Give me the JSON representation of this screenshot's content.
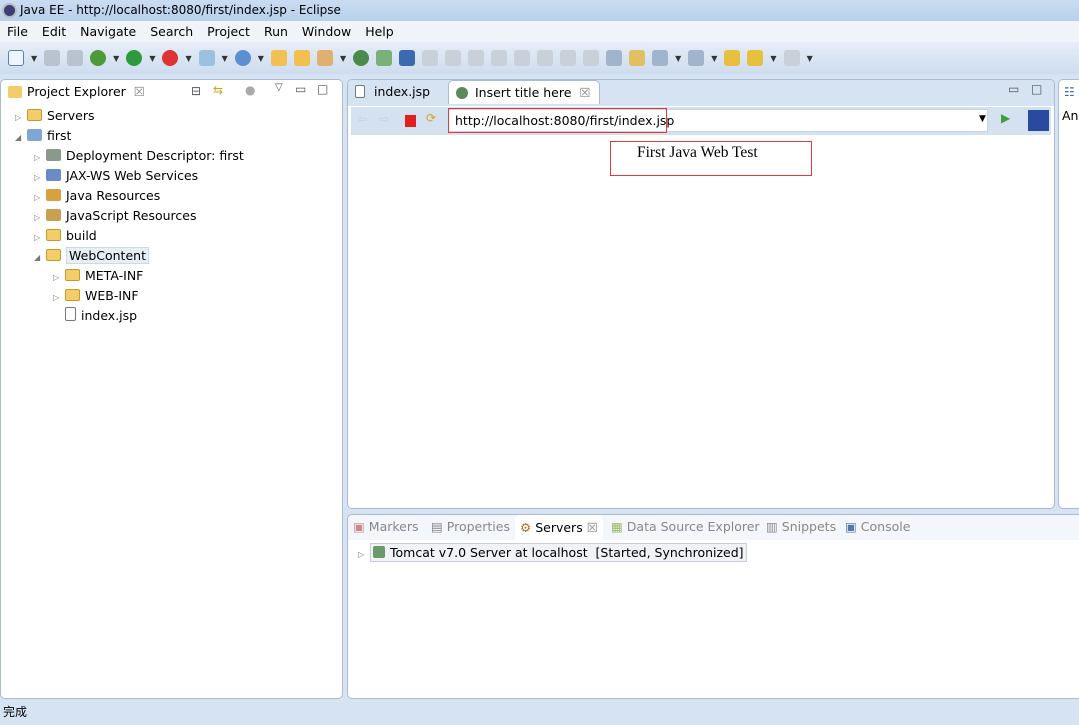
{
  "window": {
    "title": "Java EE - http://localhost:8080/first/index.jsp - Eclipse"
  },
  "menu": [
    "File",
    "Edit",
    "Navigate",
    "Search",
    "Project",
    "Run",
    "Window",
    "Help"
  ],
  "project_explorer": {
    "title": "Project Explorer",
    "items": [
      {
        "label": "Servers"
      },
      {
        "label": "first"
      },
      {
        "label": "Deployment Descriptor: first"
      },
      {
        "label": "JAX-WS Web Services"
      },
      {
        "label": "Java Resources"
      },
      {
        "label": "JavaScript Resources"
      },
      {
        "label": "build"
      },
      {
        "label": "WebContent"
      },
      {
        "label": "META-INF"
      },
      {
        "label": "WEB-INF"
      },
      {
        "label": "index.jsp"
      }
    ]
  },
  "editor": {
    "tabs": [
      {
        "label": "index.jsp"
      },
      {
        "label": "Insert title here"
      }
    ],
    "url": "http://localhost:8080/first/index.jsp",
    "page_text": "First Java Web Test"
  },
  "right_panel": {
    "label": "An"
  },
  "bottom": {
    "tabs": [
      {
        "label": "Markers"
      },
      {
        "label": "Properties"
      },
      {
        "label": "Servers"
      },
      {
        "label": "Data Source Explorer"
      },
      {
        "label": "Snippets"
      },
      {
        "label": "Console"
      }
    ],
    "server": "Tomcat v7.0 Server at localhost  [Started, Synchronized]"
  },
  "status": "完成"
}
